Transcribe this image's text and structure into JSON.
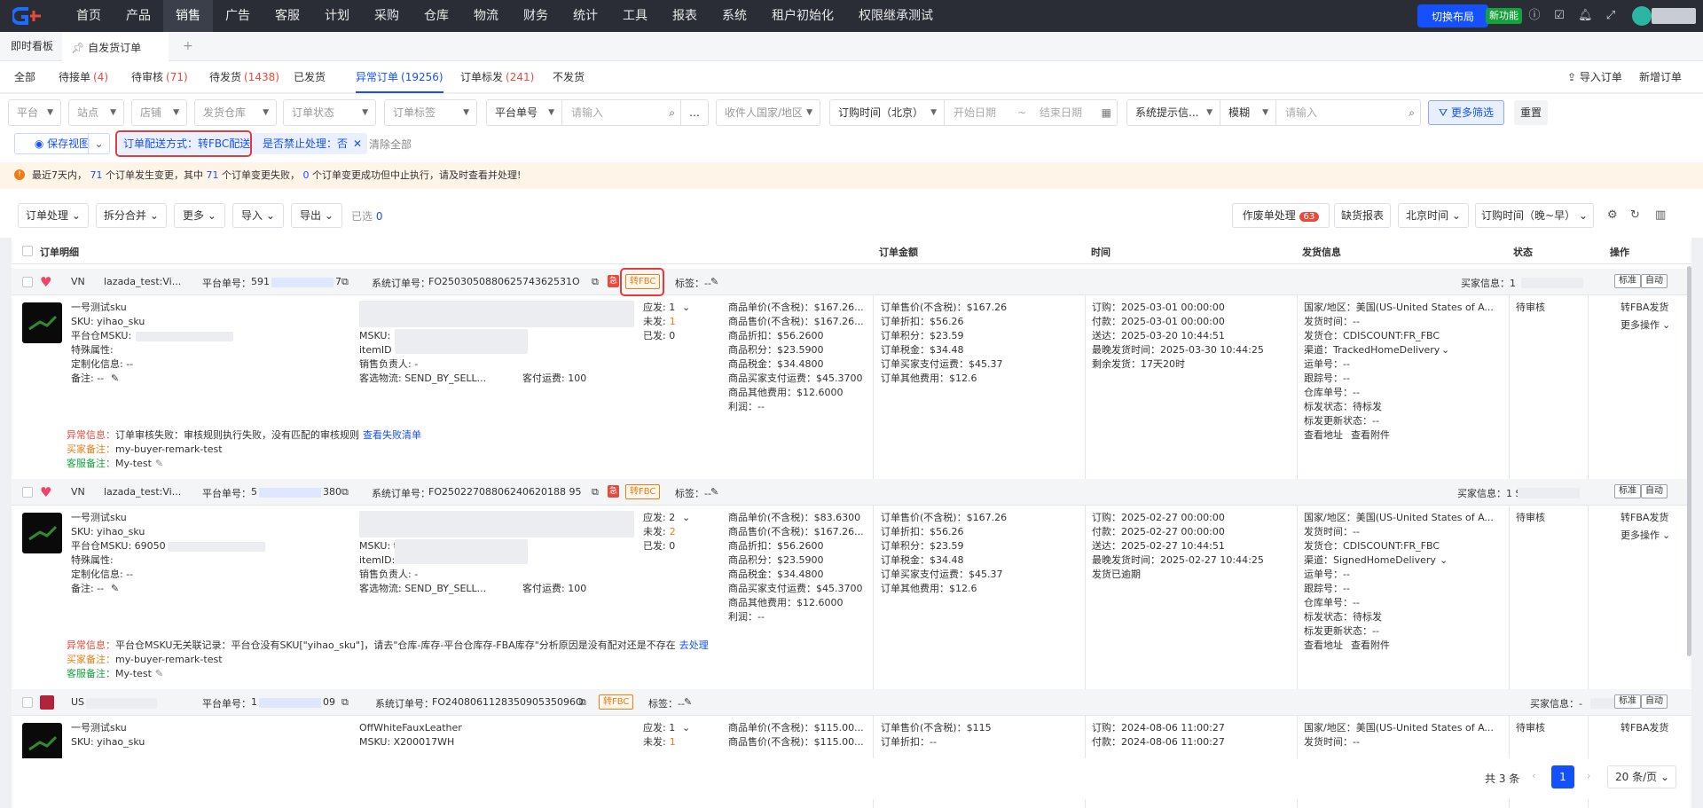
{
  "topnav": {
    "menu": [
      "首页",
      "产品",
      "销售",
      "广告",
      "客服",
      "计划",
      "采购",
      "仓库",
      "物流",
      "财务",
      "统计",
      "工具",
      "报表",
      "系统",
      "租户初始化",
      "权限继承测试"
    ],
    "active": "销售",
    "qxg_badge": "qxg",
    "switch_layout": "切换布局",
    "new_feature": "新功能"
  },
  "page_tabs": {
    "dashboard": "即时看板",
    "current": "自发货订单",
    "add": "+"
  },
  "status_tabs": [
    {
      "label": "全部",
      "count": ""
    },
    {
      "label": "待接单",
      "count": "(4)"
    },
    {
      "label": "待审核",
      "count": "(71)"
    },
    {
      "label": "待发货",
      "count": "(1438)"
    },
    {
      "label": "已发货",
      "count": ""
    },
    {
      "label": "异常订单",
      "count": "(19256)"
    },
    {
      "label": "订单标发",
      "count": "(241)"
    },
    {
      "label": "不发货",
      "count": ""
    }
  ],
  "header_actions": {
    "import_order": "导入订单",
    "new_order": "新增订单"
  },
  "filters": {
    "platform": "平台",
    "site": "站点",
    "store": "店铺",
    "warehouse": "发货仓库",
    "order_status": "订单状态",
    "order_tag": "订单标签",
    "platform_no": "平台单号",
    "search_placeholder": "请输入",
    "more_icon": "…",
    "recipient_country": "收件人国家/地区",
    "order_time": "订购时间（北京）",
    "start_date": "开始日期",
    "date_sep": "~",
    "end_date": "结束日期",
    "system_tip": "系统提示信...",
    "fuzzy": "模糊",
    "search2_placeholder": "请输入",
    "more_filter": "更多筛选",
    "reset": "重置"
  },
  "chips": {
    "save_view": "保存视图",
    "chip1": "订单配送方式：转FBC配送",
    "chip2": "是否禁止处理：否",
    "clear_all": "清除全部"
  },
  "alert": {
    "p1": "最近7天内，",
    "n1": "71",
    "p2": "个订单发生变更，其中",
    "n2": "71",
    "p3": "个订单变更失败，",
    "n3": "0",
    "p4": "个订单变更成功但中止执行，请及时查看并处理!"
  },
  "toolbar": {
    "order_process": "订单处理",
    "split_merge": "拆分合并",
    "more": "更多",
    "import": "导入",
    "export": "导出",
    "selected": "已选",
    "selected_count": "0",
    "void_process": "作废单处理",
    "void_count": "63",
    "shortage_report": "缺货报表",
    "beijing_time": "北京时间",
    "order_time_sort": "订购时间（晚~早）"
  },
  "table_header": {
    "detail": "订单明细",
    "amount": "订单金额",
    "time": "时间",
    "ship_info": "发货信息",
    "status": "状态",
    "action": "操作"
  },
  "orders": [
    {
      "country": "VN",
      "store": "lazada_test:Vi...",
      "platform_no_label": "平台单号：",
      "platform_no_a": "591",
      "platform_no_b": "7",
      "system_no_label": "系统订单号：",
      "system_no": "FO250305088062574362531O",
      "fbc_tag": "转FBC",
      "tag_label": "标签：--",
      "buyer_label": "买家信息：1",
      "product": "一号测试sku",
      "sku": "SKU: yihao_sku",
      "platform_msku": "平台仓MSKU:",
      "special": "特殊属性:",
      "custom": "定制化信息: --",
      "remark": "备注: --",
      "msku": "MSKU:",
      "item_id": "itemID",
      "seller": "销售负责人: -",
      "logistics": "客选物流: SEND_BY_SELL...",
      "shipping_fee": "客付运费: 100",
      "should": "应发: 1",
      "unshipped_label": "未发:",
      "unshipped": "1",
      "shipped": "已发: 0",
      "price_lines": [
        "商品单价(不含税)：$167.26...",
        "商品售价(不含税)：$167.26...",
        "商品折扣：$56.2600",
        "商品积分：$23.5900",
        "商品税金：$34.4800",
        "商品买家支付运费：$45.3700",
        "商品其他费用：$12.6000",
        "利润：--"
      ],
      "amount_lines": [
        "订单售价(不含税)：$167.26",
        "订单折扣：$56.26",
        "订单积分：$23.59",
        "订单税金：$34.48",
        "订单买家支付运费：$45.37",
        "订单其他费用：$12.6"
      ],
      "time_lines": [
        "订购：2025-03-01 00:00:00",
        "付款：2025-03-01 00:00:00",
        "送达：2025-03-20 10:44:51",
        "最晚发货时间：2025-03-30 10:44:25"
      ],
      "time_warn": "剩余发货：17天20时",
      "ship_lines": [
        "国家/地区：美国(US-United States of A...",
        "发货时间：--",
        "发货仓：CDISCOUNT:FR_FBC",
        "渠道：TrackedHomeDelivery",
        "运单号：--",
        "跟踪号：--",
        "仓库单号：--",
        "标发状态：待标发",
        "标发更新状态：--"
      ],
      "view_addr": "查看地址",
      "view_attach": "查看附件",
      "status": "待审核",
      "action1": "转FBA发货",
      "action2": "更多操作",
      "err_label": "异常信息：",
      "err_text": "订单审核失败：审核规则执行失败，没有匹配的审核规则",
      "err_link": "查看失败清单",
      "buyer_note_label": "买家备注：",
      "buyer_note": "my-buyer-remark-test",
      "cs_note_label": "客服备注：",
      "cs_note": "My-test",
      "btn_mark": "标准",
      "btn_auto": "自动"
    },
    {
      "country": "VN",
      "store": "lazada_test:Vi...",
      "platform_no_label": "平台单号：",
      "platform_no_a": "5",
      "platform_no_b": "380",
      "system_no_label": "系统订单号：",
      "system_no": "FO25022708806240620188 95",
      "fbc_tag": "转FBC",
      "tag_label": "标签：--",
      "buyer_label": "买家信息：1 Sc",
      "product": "一号测试sku",
      "sku": "SKU: yihao_sku",
      "platform_msku": "平台仓MSKU: 69050",
      "special": "特殊属性:",
      "custom": "定制化信息: --",
      "remark": "备注: --",
      "msku": "MSKU: t",
      "item_id": "itemID:",
      "seller": "销售负责人: -",
      "logistics": "客选物流: SEND_BY_SELL...",
      "shipping_fee": "客付运费: 100",
      "should": "应发: 2",
      "unshipped_label": "未发:",
      "unshipped": "2",
      "shipped": "已发: 0",
      "price_lines": [
        "商品单价(不含税)：$83.6300",
        "商品售价(不含税)：$167.26...",
        "商品折扣：$56.2600",
        "商品积分：$23.5900",
        "商品税金：$34.4800",
        "商品买家支付运费：$45.3700",
        "商品其他费用：$12.6000",
        "利润：--"
      ],
      "amount_lines": [
        "订单售价(不含税)：$167.26",
        "订单折扣：$56.26",
        "订单积分：$23.59",
        "订单税金：$34.48",
        "订单买家支付运费：$45.37",
        "订单其他费用：$12.6"
      ],
      "time_lines": [
        "订购：2025-02-27 00:00:00",
        "付款：2025-02-27 00:00:00",
        "送达：2025-02-27 10:44:51",
        "最晚发货时间：2025-02-27 10:44:25"
      ],
      "time_warn": "发货已逾期",
      "ship_lines": [
        "国家/地区：美国(US-United States of A...",
        "发货时间：--",
        "发货仓：CDISCOUNT:FR_FBC",
        "渠道：SignedHomeDelivery",
        "运单号：--",
        "跟踪号：--",
        "仓库单号：--",
        "标发状态：待标发",
        "标发更新状态：--"
      ],
      "view_addr": "查看地址",
      "view_attach": "查看附件",
      "status": "待审核",
      "action1": "转FBA发货",
      "action2": "更多操作",
      "err_label": "异常信息：",
      "err_text": "平台仓MSKU无关联记录：平台仓没有SKU[\"yihao_sku\"]，请去\"仓库-库存-平台仓库存-FBA库存\"分析原因是没有配对还是不存在",
      "err_link": "去处理",
      "buyer_note_label": "买家备注：",
      "buyer_note": "my-buyer-remark-test",
      "cs_note_label": "客服备注：",
      "cs_note": "My-test",
      "btn_mark": "标准",
      "btn_auto": "自动"
    },
    {
      "country": "US",
      "store": "...",
      "platform_no_label": "平台单号：",
      "platform_no_a": "1",
      "platform_no_b": "09",
      "system_no_label": "系统订单号：",
      "system_no": "FO240806112835090535096O",
      "fbc_tag": "转FBC",
      "tag_label": "标签：--",
      "buyer_label": "买家信息：-",
      "product": "一号测试sku",
      "sku": "SKU: yihao_sku",
      "msku_name": "OffWhiteFauxLeather",
      "msku": "MSKU: X200017WH",
      "should": "应发: 1",
      "unshipped_label": "未发:",
      "unshipped": "1",
      "price_lines": [
        "商品单价(不含税)：$115.00...",
        "商品售价(不含税)：$115.00..."
      ],
      "amount_lines": [
        "订单售价(不含税)：$115",
        "订单折扣：--"
      ],
      "time_lines": [
        "订购：2024-08-06 11:00:27",
        "付款：2024-08-06 11:00:27"
      ],
      "ship_lines": [
        "国家/地区：美国(US-United States of A...",
        "发货时间：--"
      ],
      "status": "待审核",
      "action1": "转FBA发货",
      "btn_mark": "标准",
      "btn_auto": "自动"
    }
  ],
  "pagination": {
    "total": "共 3 条",
    "page": "1",
    "page_size": "20 条/页"
  }
}
